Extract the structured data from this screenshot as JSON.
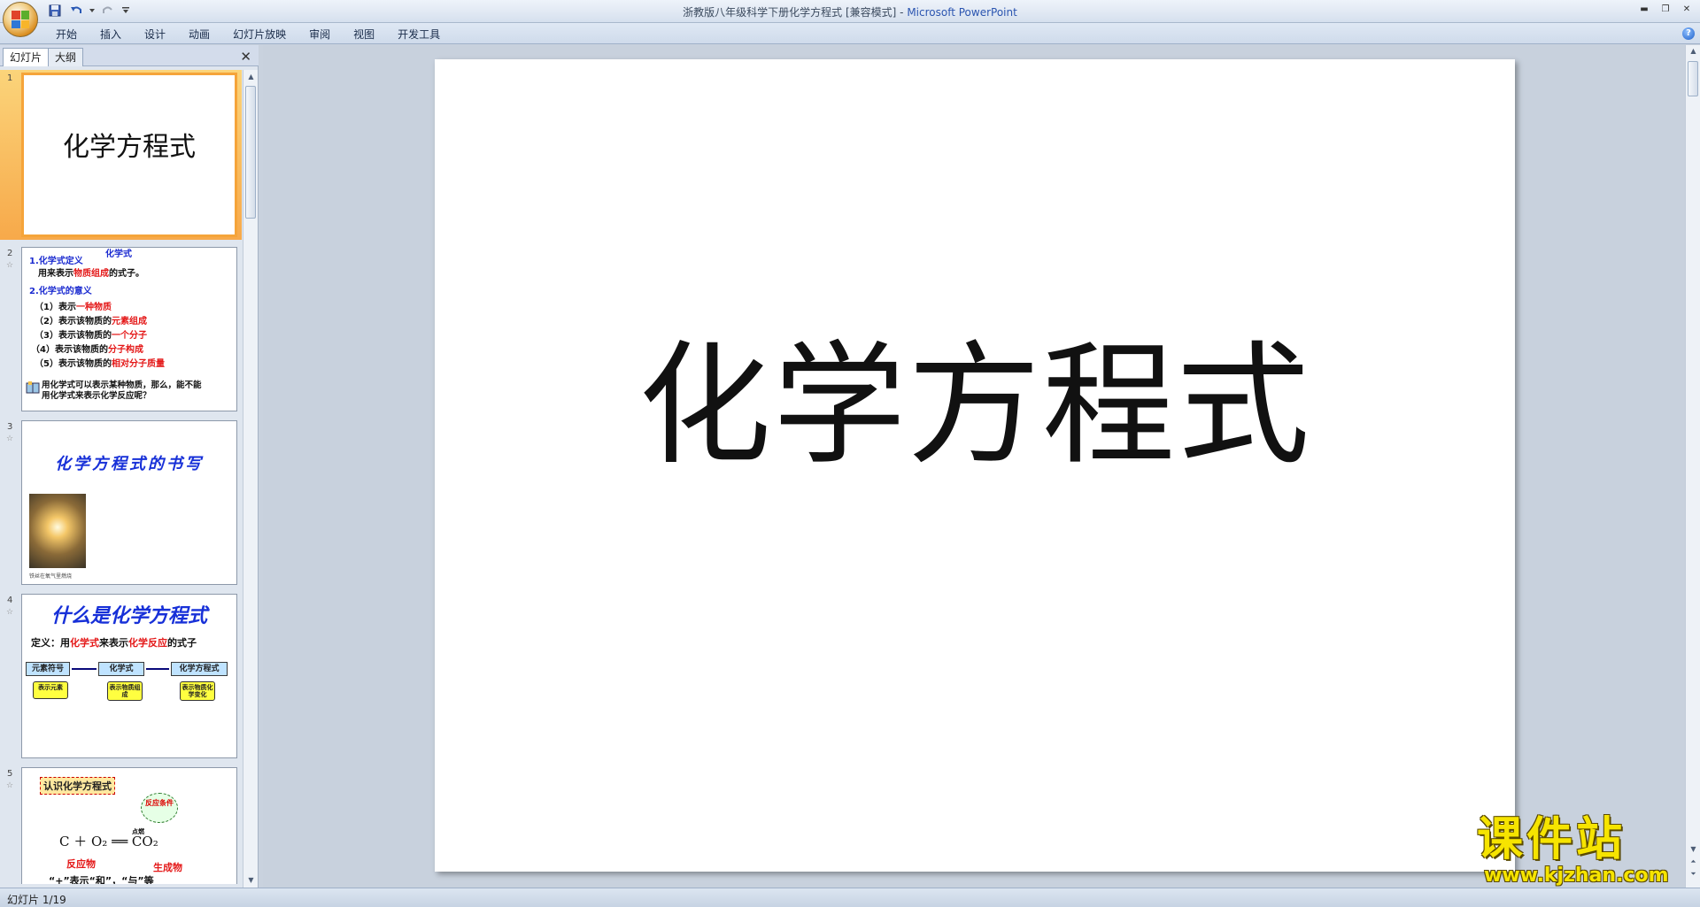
{
  "window": {
    "title_doc": "浙教版八年级科学下册化学方程式 [兼容模式] - ",
    "title_app": "Microsoft PowerPoint",
    "controls": {
      "minimize": "▬",
      "restore": "❐",
      "close": "✕"
    }
  },
  "ribbon": {
    "tabs": [
      "开始",
      "插入",
      "设计",
      "动画",
      "幻灯片放映",
      "审阅",
      "视图",
      "开发工具"
    ],
    "help": "?"
  },
  "left_pane": {
    "tabs": {
      "slides": "幻灯片",
      "outline": "大纲"
    },
    "close": "✕"
  },
  "slides": [
    {
      "num": "1",
      "title": "化学方程式"
    },
    {
      "num": "2",
      "heading": "化学式",
      "def_title": "1.化学式定义",
      "def_prefix": "用来表示",
      "def_red": "物质组成",
      "def_suffix": "的式子。",
      "meaning_title": "2.化学式的意义",
      "items": [
        {
          "prefix": "（1）表示",
          "red": "一种物质"
        },
        {
          "prefix": "（2）表示该物质的",
          "red": "元素组成"
        },
        {
          "prefix": "（3）表示该物质的",
          "red": "一个分子"
        },
        {
          "prefix": "（4）表示该物质的",
          "red": "分子构成"
        },
        {
          "prefix": "（5）表示该物质的",
          "red": "相对分子质量"
        }
      ],
      "question_line1": "用化学式可以表示某种物质，那么，能不能",
      "question_line2": "用化学式来表示化学反应呢？"
    },
    {
      "num": "3",
      "title": "化学方程式的书写",
      "caption": "铁丝在氧气里燃烧"
    },
    {
      "num": "4",
      "title": "什么是化学方程式",
      "def_prefix": "定义：用",
      "def_red1": "化学式",
      "def_mid": "来表示",
      "def_red2": "化学反应",
      "def_suffix": "的式子",
      "boxes": [
        "元素符号",
        "化学式",
        "化学方程式"
      ],
      "notes": [
        "表示元素",
        "表示物质组成",
        "表示物质化学变化"
      ]
    },
    {
      "num": "5",
      "tag": "认识化学方程式",
      "bubble": "反应条件",
      "condition": "点燃",
      "equation": "C ＋ O₂ ══ CO₂",
      "reactant": "反应物",
      "product": "生成物",
      "bottom": "“+”表示“和”，“与”等"
    }
  ],
  "main_slide": {
    "title": "化学方程式"
  },
  "status": {
    "slide_counter": "幻灯片 1/19"
  },
  "watermark": {
    "big": "课件站",
    "small": "www.kjzhan.com"
  },
  "colors": {
    "accent": "#f5a43a",
    "title_blue": "#1730d8",
    "highlight_red": "#e41818"
  }
}
